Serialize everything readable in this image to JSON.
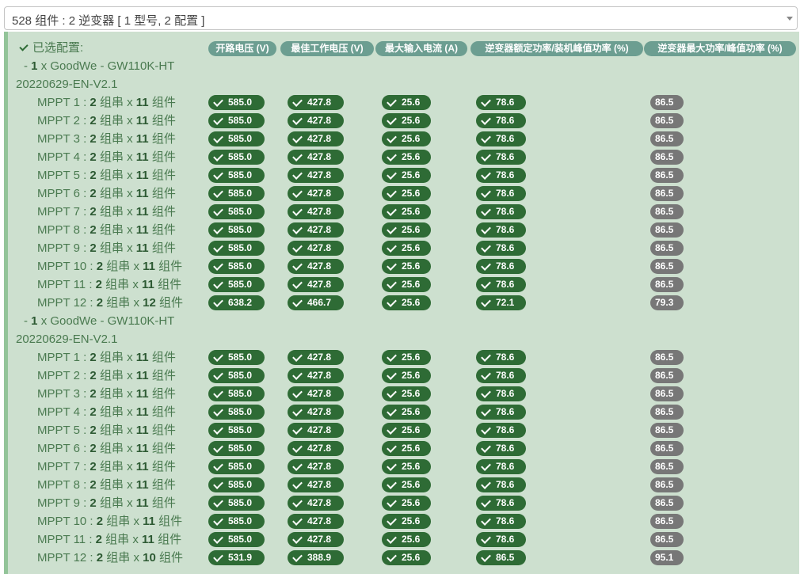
{
  "select": {
    "value": "528 组件 : 2 逆变器 [ 1 型号, 2 配置 ]"
  },
  "panel": {
    "selected_label": "已选配置:",
    "headers": [
      "开路电压 (V)",
      "最佳工作电压 (V)",
      "最大输入电流 (A)",
      "逆变器额定功率/装机峰值功率 (%)",
      "逆变器最大功率/峰值功率 (%)"
    ],
    "inverters": [
      {
        "count": "1",
        "model": "GoodWe - GW110K-HT",
        "version": "20220629-EN-V2.1",
        "mppts": [
          {
            "name": "MPPT 1",
            "strings": "2",
            "modules": "11",
            "voc": "585.0",
            "vmp": "427.8",
            "imax": "25.6",
            "ratio": "78.6",
            "max": "86.5"
          },
          {
            "name": "MPPT 2",
            "strings": "2",
            "modules": "11",
            "voc": "585.0",
            "vmp": "427.8",
            "imax": "25.6",
            "ratio": "78.6",
            "max": "86.5"
          },
          {
            "name": "MPPT 3",
            "strings": "2",
            "modules": "11",
            "voc": "585.0",
            "vmp": "427.8",
            "imax": "25.6",
            "ratio": "78.6",
            "max": "86.5"
          },
          {
            "name": "MPPT 4",
            "strings": "2",
            "modules": "11",
            "voc": "585.0",
            "vmp": "427.8",
            "imax": "25.6",
            "ratio": "78.6",
            "max": "86.5"
          },
          {
            "name": "MPPT 5",
            "strings": "2",
            "modules": "11",
            "voc": "585.0",
            "vmp": "427.8",
            "imax": "25.6",
            "ratio": "78.6",
            "max": "86.5"
          },
          {
            "name": "MPPT 6",
            "strings": "2",
            "modules": "11",
            "voc": "585.0",
            "vmp": "427.8",
            "imax": "25.6",
            "ratio": "78.6",
            "max": "86.5"
          },
          {
            "name": "MPPT 7",
            "strings": "2",
            "modules": "11",
            "voc": "585.0",
            "vmp": "427.8",
            "imax": "25.6",
            "ratio": "78.6",
            "max": "86.5"
          },
          {
            "name": "MPPT 8",
            "strings": "2",
            "modules": "11",
            "voc": "585.0",
            "vmp": "427.8",
            "imax": "25.6",
            "ratio": "78.6",
            "max": "86.5"
          },
          {
            "name": "MPPT 9",
            "strings": "2",
            "modules": "11",
            "voc": "585.0",
            "vmp": "427.8",
            "imax": "25.6",
            "ratio": "78.6",
            "max": "86.5"
          },
          {
            "name": "MPPT 10",
            "strings": "2",
            "modules": "11",
            "voc": "585.0",
            "vmp": "427.8",
            "imax": "25.6",
            "ratio": "78.6",
            "max": "86.5"
          },
          {
            "name": "MPPT 11",
            "strings": "2",
            "modules": "11",
            "voc": "585.0",
            "vmp": "427.8",
            "imax": "25.6",
            "ratio": "78.6",
            "max": "86.5"
          },
          {
            "name": "MPPT 12",
            "strings": "2",
            "modules": "12",
            "voc": "638.2",
            "vmp": "466.7",
            "imax": "25.6",
            "ratio": "72.1",
            "max": "79.3"
          }
        ]
      },
      {
        "count": "1",
        "model": "GoodWe - GW110K-HT",
        "version": "20220629-EN-V2.1",
        "mppts": [
          {
            "name": "MPPT 1",
            "strings": "2",
            "modules": "11",
            "voc": "585.0",
            "vmp": "427.8",
            "imax": "25.6",
            "ratio": "78.6",
            "max": "86.5"
          },
          {
            "name": "MPPT 2",
            "strings": "2",
            "modules": "11",
            "voc": "585.0",
            "vmp": "427.8",
            "imax": "25.6",
            "ratio": "78.6",
            "max": "86.5"
          },
          {
            "name": "MPPT 3",
            "strings": "2",
            "modules": "11",
            "voc": "585.0",
            "vmp": "427.8",
            "imax": "25.6",
            "ratio": "78.6",
            "max": "86.5"
          },
          {
            "name": "MPPT 4",
            "strings": "2",
            "modules": "11",
            "voc": "585.0",
            "vmp": "427.8",
            "imax": "25.6",
            "ratio": "78.6",
            "max": "86.5"
          },
          {
            "name": "MPPT 5",
            "strings": "2",
            "modules": "11",
            "voc": "585.0",
            "vmp": "427.8",
            "imax": "25.6",
            "ratio": "78.6",
            "max": "86.5"
          },
          {
            "name": "MPPT 6",
            "strings": "2",
            "modules": "11",
            "voc": "585.0",
            "vmp": "427.8",
            "imax": "25.6",
            "ratio": "78.6",
            "max": "86.5"
          },
          {
            "name": "MPPT 7",
            "strings": "2",
            "modules": "11",
            "voc": "585.0",
            "vmp": "427.8",
            "imax": "25.6",
            "ratio": "78.6",
            "max": "86.5"
          },
          {
            "name": "MPPT 8",
            "strings": "2",
            "modules": "11",
            "voc": "585.0",
            "vmp": "427.8",
            "imax": "25.6",
            "ratio": "78.6",
            "max": "86.5"
          },
          {
            "name": "MPPT 9",
            "strings": "2",
            "modules": "11",
            "voc": "585.0",
            "vmp": "427.8",
            "imax": "25.6",
            "ratio": "78.6",
            "max": "86.5"
          },
          {
            "name": "MPPT 10",
            "strings": "2",
            "modules": "11",
            "voc": "585.0",
            "vmp": "427.8",
            "imax": "25.6",
            "ratio": "78.6",
            "max": "86.5"
          },
          {
            "name": "MPPT 11",
            "strings": "2",
            "modules": "11",
            "voc": "585.0",
            "vmp": "427.8",
            "imax": "25.6",
            "ratio": "78.6",
            "max": "86.5"
          },
          {
            "name": "MPPT 12",
            "strings": "2",
            "modules": "10",
            "voc": "531.9",
            "vmp": "388.9",
            "imax": "25.6",
            "ratio": "86.5",
            "max": "95.1"
          }
        ]
      }
    ],
    "units": {
      "times": "x",
      "string_unit": "组串",
      "module_unit": "组件",
      "sep": ":",
      "dash": "-"
    }
  }
}
